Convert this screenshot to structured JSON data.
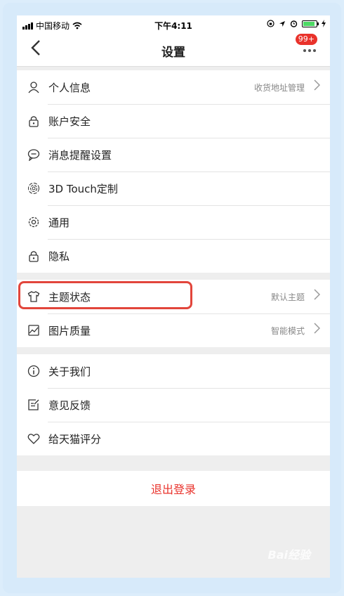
{
  "status_bar": {
    "carrier": "中国移动",
    "time": "下午4:11"
  },
  "nav": {
    "title": "设置",
    "badge": "99+"
  },
  "groups": [
    [
      {
        "label": "个人信息",
        "value": "收货地址管理",
        "icon": "person-icon"
      },
      {
        "label": "账户安全",
        "icon": "lock-icon"
      },
      {
        "label": "消息提醒设置",
        "icon": "message-icon"
      },
      {
        "label": "3D Touch定制",
        "icon": "fingerprint-icon"
      },
      {
        "label": "通用",
        "icon": "gear-icon"
      },
      {
        "label": "隐私",
        "icon": "privacy-lock-icon"
      }
    ],
    [
      {
        "label": "主题状态",
        "value": "默认主题",
        "icon": "tshirt-icon"
      },
      {
        "label": "图片质量",
        "value": "智能模式",
        "icon": "image-icon"
      }
    ],
    [
      {
        "label": "关于我们",
        "icon": "info-icon"
      },
      {
        "label": "意见反馈",
        "icon": "feedback-icon"
      },
      {
        "label": "给天猫评分",
        "icon": "heart-icon"
      }
    ]
  ],
  "logout_label": "退出登录",
  "watermark": "Bai经验",
  "colors": {
    "accent": "#e9322b",
    "highlight": "#e2453b"
  }
}
